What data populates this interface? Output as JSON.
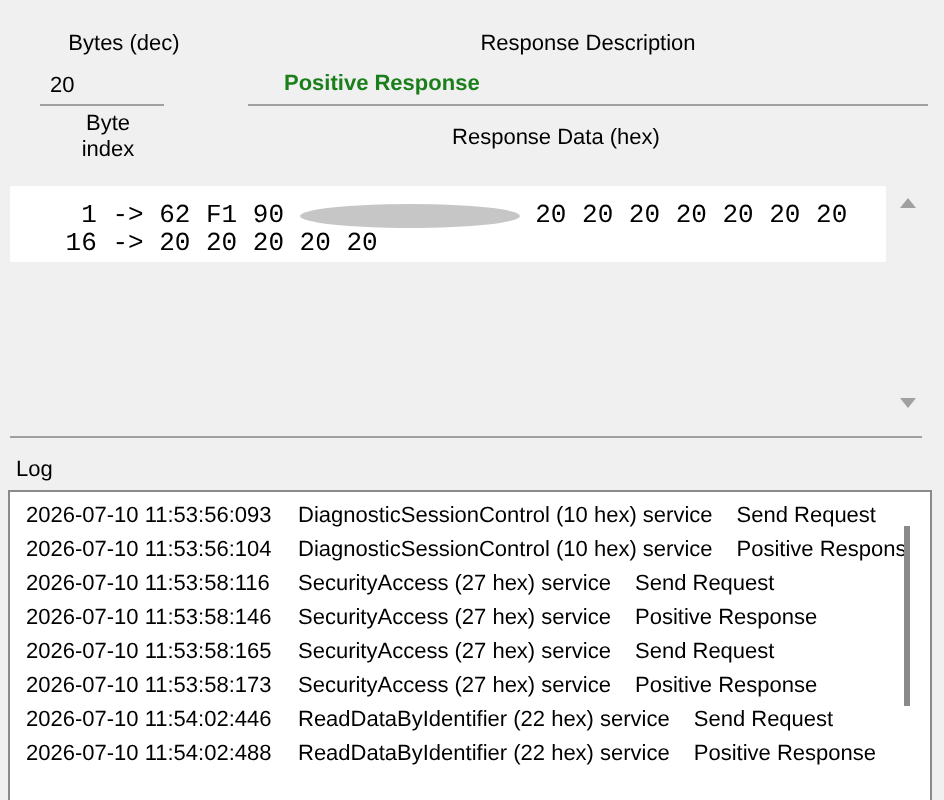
{
  "response": {
    "bytes_label": "Bytes (dec)",
    "bytes_value": "20",
    "description_label": "Response Description",
    "description_value": "Positive Response",
    "index_label": "Byte index",
    "data_label": "Response Data (hex)",
    "data_lines": [
      {
        "index": "1",
        "arrow": "->",
        "before": "62 F1 90",
        "redacted": true,
        "after": "20 20 20 20 20 20 20"
      },
      {
        "index": "16",
        "arrow": "->",
        "before": "20 20 20 20 20",
        "redacted": false
      }
    ]
  },
  "log": {
    "title": "Log",
    "rows": [
      {
        "time": "2026-07-10 11:53:56:093",
        "service": "DiagnosticSessionControl (10 hex) service",
        "status": "Send Request"
      },
      {
        "time": "2026-07-10 11:53:56:104",
        "service": "DiagnosticSessionControl (10 hex) service",
        "status": "Positive Respons"
      },
      {
        "time": "2026-07-10 11:53:58:116",
        "service": "SecurityAccess (27 hex) service",
        "status": "Send Request"
      },
      {
        "time": "2026-07-10 11:53:58:146",
        "service": "SecurityAccess (27 hex) service",
        "status": "Positive Response"
      },
      {
        "time": "2026-07-10 11:53:58:165",
        "service": "SecurityAccess (27 hex) service",
        "status": "Send Request"
      },
      {
        "time": "2026-07-10 11:53:58:173",
        "service": "SecurityAccess (27 hex) service",
        "status": "Positive Response"
      },
      {
        "time": "2026-07-10 11:54:02:446",
        "service": "ReadDataByIdentifier (22 hex) service",
        "status": "Send Request"
      },
      {
        "time": "2026-07-10 11:54:02:488",
        "service": "ReadDataByIdentifier (22 hex) service",
        "status": "Positive Response"
      }
    ]
  }
}
